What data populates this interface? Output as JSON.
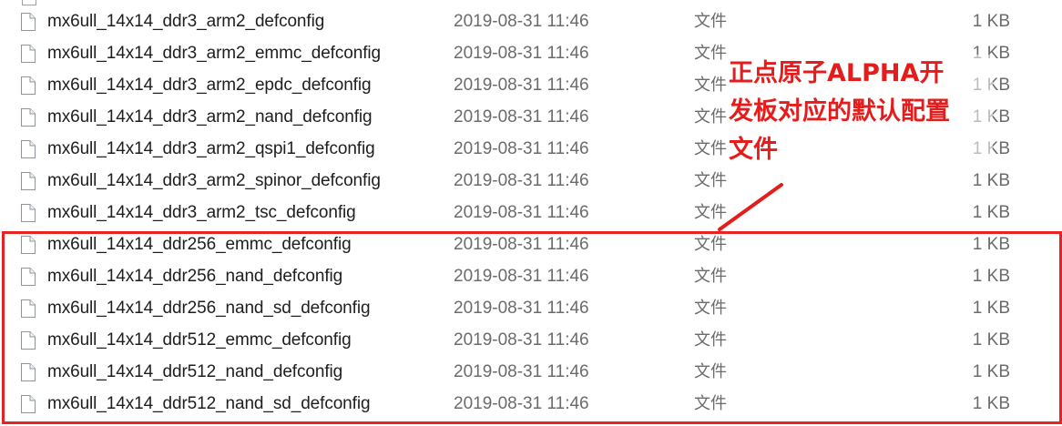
{
  "files": [
    {
      "name": "mx6ull_14x14_ddr3_arm2_defconfig",
      "date": "2019-08-31 11:46",
      "type": "文件",
      "size": "1 KB"
    },
    {
      "name": "mx6ull_14x14_ddr3_arm2_emmc_defconfig",
      "date": "2019-08-31 11:46",
      "type": "文件",
      "size": "1 KB"
    },
    {
      "name": "mx6ull_14x14_ddr3_arm2_epdc_defconfig",
      "date": "2019-08-31 11:46",
      "type": "文件",
      "size": "1 KB"
    },
    {
      "name": "mx6ull_14x14_ddr3_arm2_nand_defconfig",
      "date": "2019-08-31 11:46",
      "type": "文件",
      "size": "1 KB"
    },
    {
      "name": "mx6ull_14x14_ddr3_arm2_qspi1_defconfig",
      "date": "2019-08-31 11:46",
      "type": "文件",
      "size": "1 KB"
    },
    {
      "name": "mx6ull_14x14_ddr3_arm2_spinor_defconfig",
      "date": "2019-08-31 11:46",
      "type": "文件",
      "size": "1 KB"
    },
    {
      "name": "mx6ull_14x14_ddr3_arm2_tsc_defconfig",
      "date": "2019-08-31 11:46",
      "type": "文件",
      "size": "1 KB"
    },
    {
      "name": "mx6ull_14x14_ddr256_emmc_defconfig",
      "date": "2019-08-31 11:46",
      "type": "文件",
      "size": "1 KB"
    },
    {
      "name": "mx6ull_14x14_ddr256_nand_defconfig",
      "date": "2019-08-31 11:46",
      "type": "文件",
      "size": "1 KB"
    },
    {
      "name": "mx6ull_14x14_ddr256_nand_sd_defconfig",
      "date": "2019-08-31 11:46",
      "type": "文件",
      "size": "1 KB"
    },
    {
      "name": "mx6ull_14x14_ddr512_emmc_defconfig",
      "date": "2019-08-31 11:46",
      "type": "文件",
      "size": "1 KB"
    },
    {
      "name": "mx6ull_14x14_ddr512_nand_defconfig",
      "date": "2019-08-31 11:46",
      "type": "文件",
      "size": "1 KB"
    },
    {
      "name": "mx6ull_14x14_ddr512_nand_sd_defconfig",
      "date": "2019-08-31 11:46",
      "type": "文件",
      "size": "1 KB"
    }
  ],
  "file_icon": "document-icon",
  "annotation": {
    "lines": [
      "正点原子ALPHA开",
      "发板对应的默认配置",
      "文件"
    ],
    "color": "#e51c1c"
  },
  "highlight_color": "#e52323"
}
